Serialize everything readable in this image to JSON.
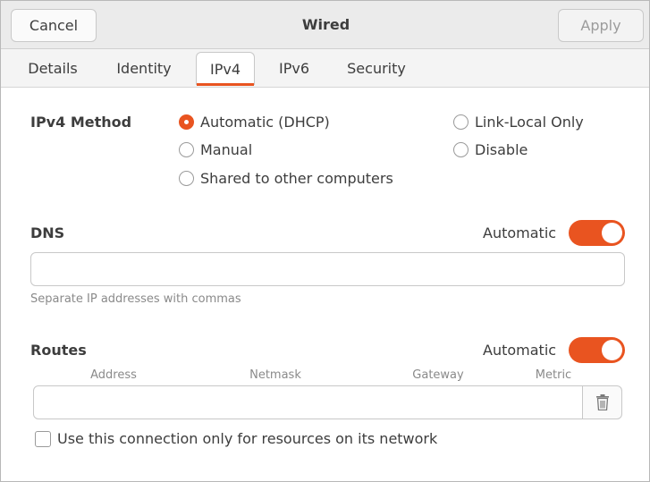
{
  "header": {
    "cancel_label": "Cancel",
    "title": "Wired",
    "apply_label": "Apply"
  },
  "tabs": [
    {
      "label": "Details"
    },
    {
      "label": "Identity"
    },
    {
      "label": "IPv4",
      "active": true
    },
    {
      "label": "IPv6"
    },
    {
      "label": "Security"
    }
  ],
  "ipv4": {
    "label": "IPv4 Method",
    "options": [
      {
        "label": "Automatic (DHCP)",
        "checked": true
      },
      {
        "label": "Manual",
        "checked": false
      },
      {
        "label": "Shared to other computers",
        "checked": false
      },
      {
        "label": "Link-Local Only",
        "checked": false
      },
      {
        "label": "Disable",
        "checked": false
      }
    ]
  },
  "dns": {
    "label": "DNS",
    "automatic_label": "Automatic",
    "automatic_on": true,
    "value": "",
    "hint": "Separate IP addresses with commas"
  },
  "routes": {
    "label": "Routes",
    "automatic_label": "Automatic",
    "automatic_on": true,
    "columns": [
      "Address",
      "Netmask",
      "Gateway",
      "Metric"
    ],
    "restrict_label": "Use this connection only for resources on its network",
    "restrict_checked": false
  },
  "colors": {
    "accent": "#e95420",
    "headerbar": "#ebebeb"
  }
}
